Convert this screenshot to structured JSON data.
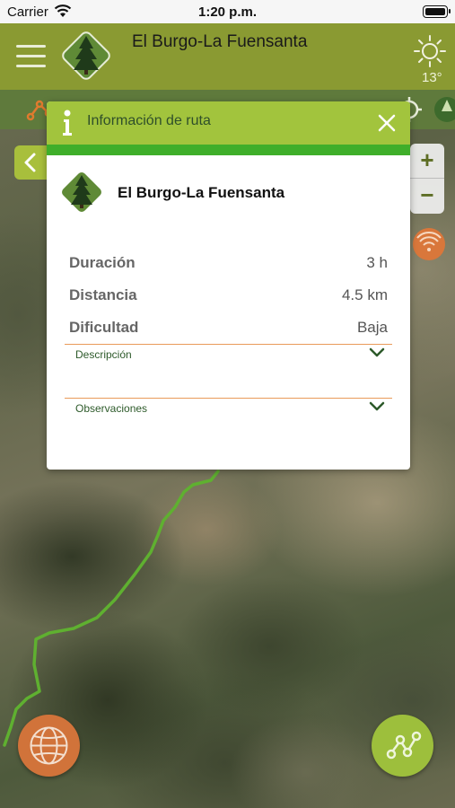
{
  "statusbar": {
    "carrier": "Carrier",
    "time": "1:20 p.m."
  },
  "header": {
    "title": "El Burgo-La Fuensanta",
    "temperature": "13°",
    "menu_icon": "hamburger-menu-icon",
    "weather_icon": "sun-icon",
    "brand_color": "#8a9a32"
  },
  "map_controls": {
    "zoom_in": "+",
    "zoom_out": "−"
  },
  "modal": {
    "title": "Información de ruta",
    "route_name": "El Burgo-La Fuensanta",
    "stats": [
      {
        "label": "Duración",
        "value": "3 h"
      },
      {
        "label": "Distancia",
        "value": "4.5 km"
      },
      {
        "label": "Dificultad",
        "value": "Baja"
      }
    ],
    "sections": [
      {
        "label": "Descripción"
      },
      {
        "label": "Observaciones"
      }
    ],
    "header_color": "#a2c43d",
    "accent_bar_color": "#3fae2a",
    "divider_color": "#e99a5a"
  }
}
